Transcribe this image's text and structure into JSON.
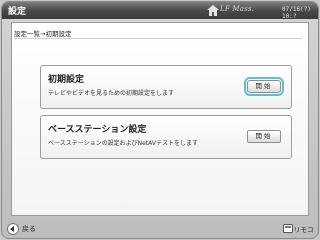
{
  "window": {
    "title": "設定"
  },
  "header": {
    "brand": "LF Mass.",
    "datetime": "07/16(?) 10:?"
  },
  "breadcrumb": "設定一覧→初期設定",
  "cards": [
    {
      "title": "初期設定",
      "description": "テレビやビデオを見るための初期設定をします",
      "button_label": "開始",
      "focused": true
    },
    {
      "title": "ベースステーション設定",
      "description": "ベースステーションの設定およびNetAVテストをします",
      "button_label": "開始",
      "focused": false
    }
  ],
  "footer": {
    "back_label": "戻る",
    "remote_label": "リモコン"
  },
  "icons": [
    "home-icon",
    "back-icon",
    "remote-icon"
  ],
  "colors": {
    "focus_ring": "#5ec0c8",
    "titlebar": "#4a4a4a"
  }
}
